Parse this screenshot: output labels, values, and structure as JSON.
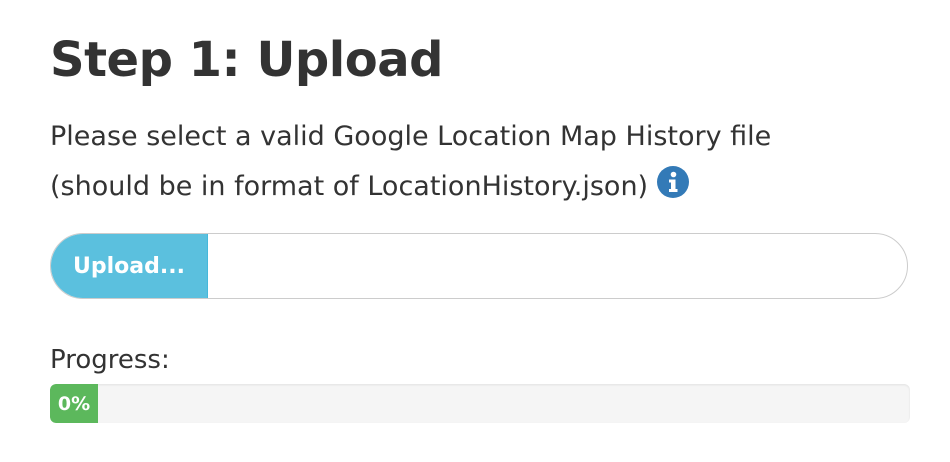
{
  "step": {
    "title": "Step 1: Upload",
    "description_line1": "Please select a valid Google Location Map History file",
    "description_line2": "(should be in format of LocationHistory.json)",
    "info_icon": "info-circle-icon"
  },
  "upload": {
    "button_label": "Upload...",
    "file_value": ""
  },
  "progress": {
    "label": "Progress:",
    "value_text": "0%",
    "fraction": 0
  },
  "colors": {
    "upload_button": "#5bc0de",
    "progress_bar": "#5cb85c",
    "info_icon": "#337ab7",
    "track": "#f5f5f5"
  }
}
